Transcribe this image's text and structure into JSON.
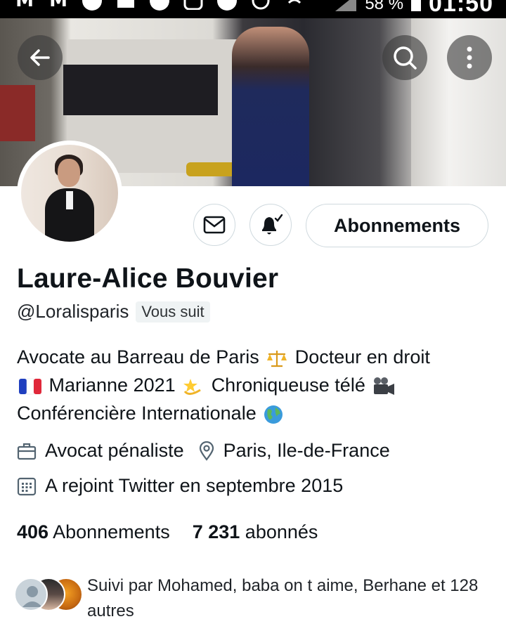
{
  "status_bar": {
    "battery_percent": "58 %",
    "time": "01:50",
    "icons": [
      "gmail-icon",
      "gmail-icon",
      "circle-icon",
      "image-icon",
      "football-icon",
      "instagram-icon",
      "minus-circle-icon",
      "alarm-icon",
      "wifi-icon",
      "signal-icon",
      "battery-icon"
    ]
  },
  "header": {
    "back_icon": "arrow-left-icon",
    "search_icon": "search-icon",
    "more_icon": "more-vertical-icon"
  },
  "profile": {
    "name": "Laure-Alice Bouvier",
    "handle": "@Loralisparis",
    "follows_you_badge": "Vous suit",
    "follow_button_label": "Abonnements",
    "bio_lines": [
      {
        "text_a": "Avocate au Barreau de Paris",
        "emoji_a": "scales-icon",
        "text_b": "Docteur en droit"
      },
      {
        "emoji_a": "france-flag-icon",
        "text_a": "Marianne 2021",
        "emoji_b": "dizzy-star-icon",
        "text_b": "Chroniqueuse télé",
        "emoji_c": "movie-camera-icon"
      },
      {
        "text_a": "Conférencière Internationale",
        "emoji_a": "globe-icon"
      }
    ],
    "profession": "Avocat pénaliste",
    "location": "Paris, Ile-de-France",
    "joined": "A rejoint Twitter en septembre 2015",
    "following_count": "406",
    "following_label": "Abonnements",
    "followers_count": "7 231",
    "followers_label": "abonnés",
    "followed_by_text": "Suivi par Mohamed, baba on t aime, Berhane et 128 autres"
  },
  "colors": {
    "text": "#0f1419",
    "border": "#cfd9de",
    "badge_bg": "#eff3f4"
  }
}
